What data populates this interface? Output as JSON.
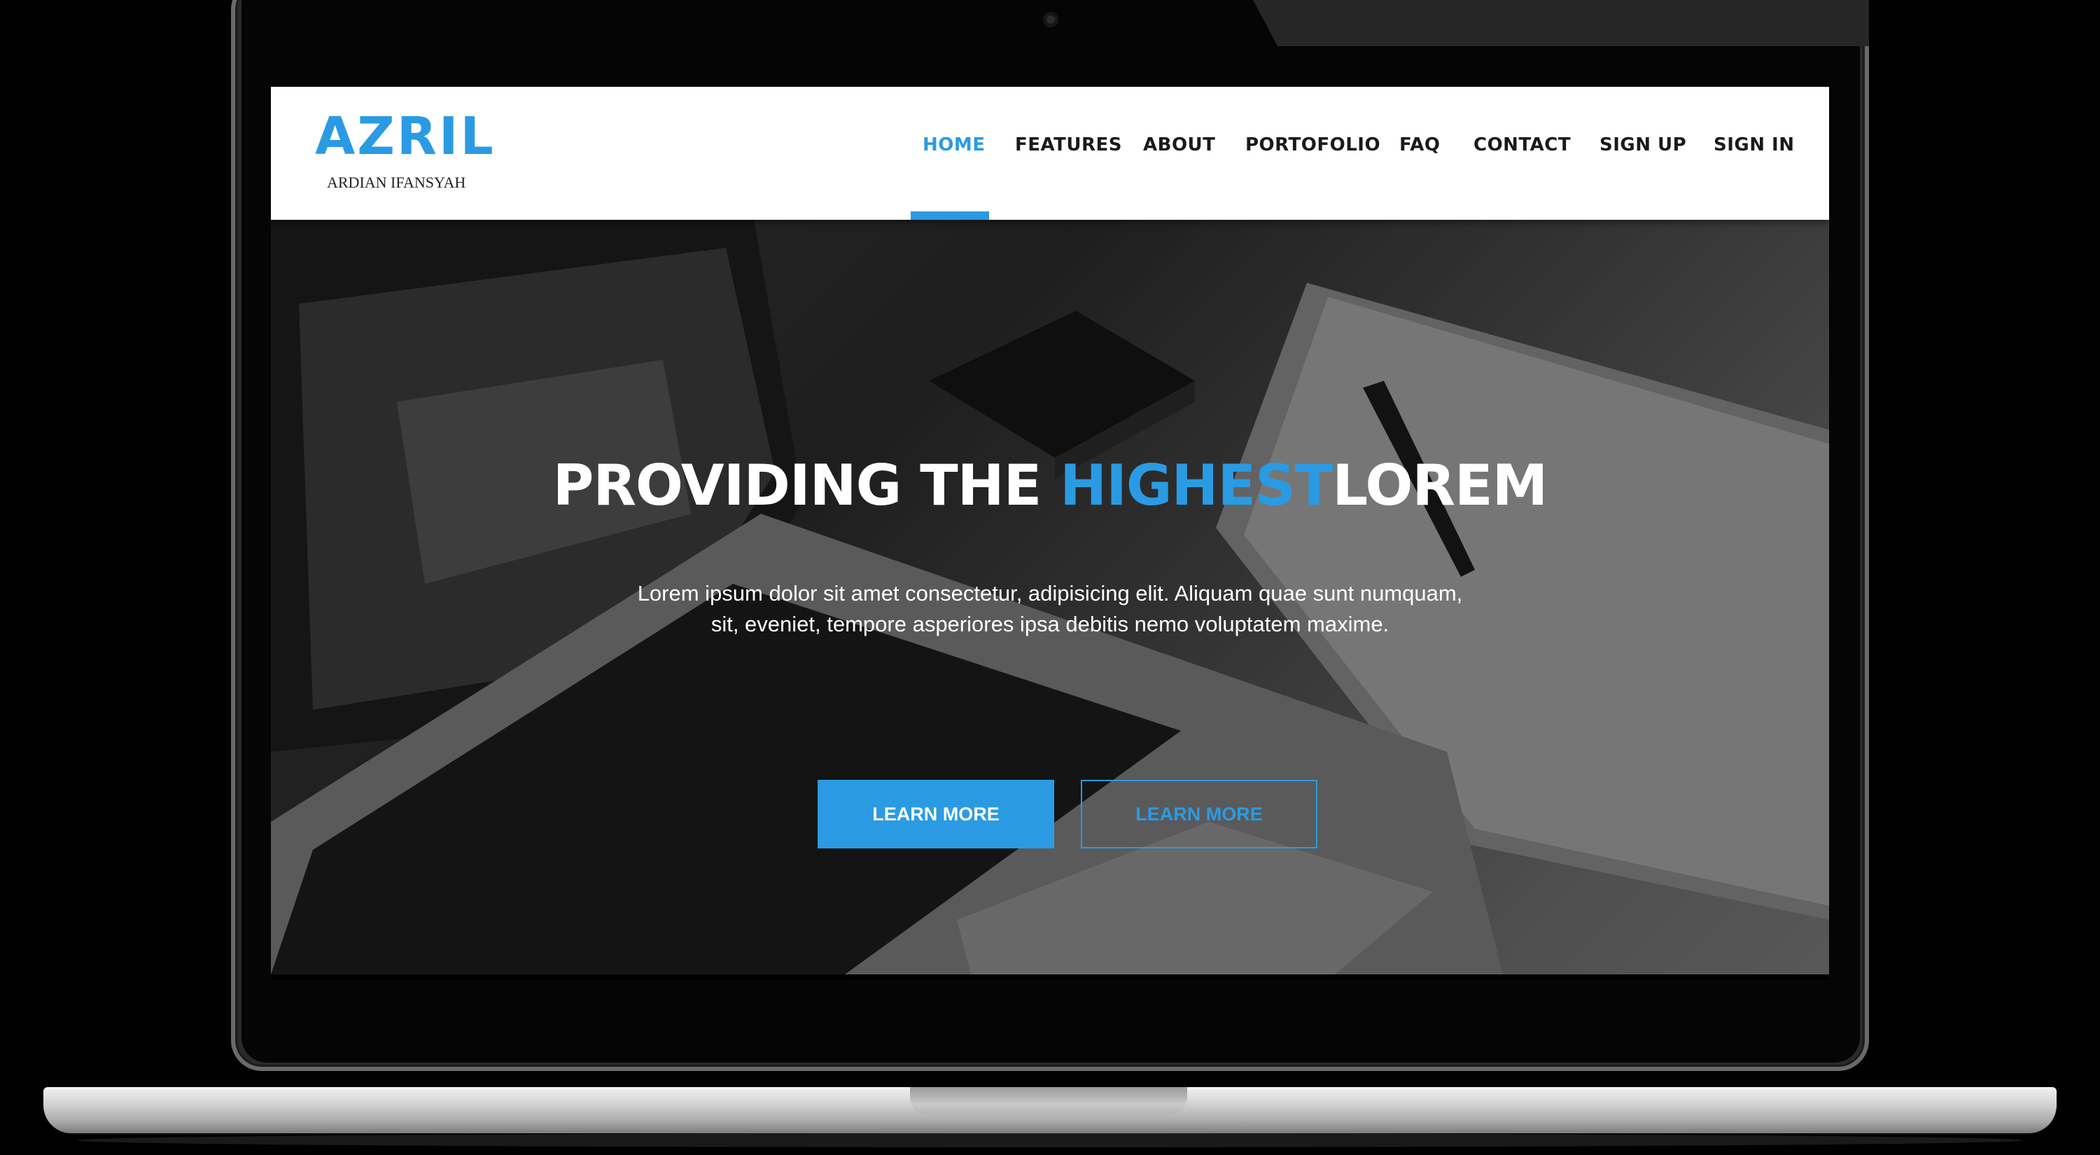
{
  "brand": {
    "name": "AZRIL",
    "tagline": "ARDIAN IFANSYAH",
    "accent_color": "#2a9be3"
  },
  "nav": {
    "active": "HOME",
    "items": [
      "HOME",
      "FEATURES",
      "ABOUT",
      "PORTOFOLIO",
      "FAQ",
      "CONTACT",
      "SIGN UP",
      "SIGN IN"
    ]
  },
  "hero": {
    "headline_part1": "PROVIDING THE ",
    "headline_accent": "HIGHEST",
    "headline_part2": "LOREM",
    "text": "Lorem ipsum dolor sit amet consectetur, adipisicing elit. Aliquam quae sunt numquam, sit, eveniet, tempore asperiores ipsa debitis nemo voluptatem maxime.",
    "primary_button": "LEARN MORE",
    "secondary_button": "LEARN MORE"
  }
}
